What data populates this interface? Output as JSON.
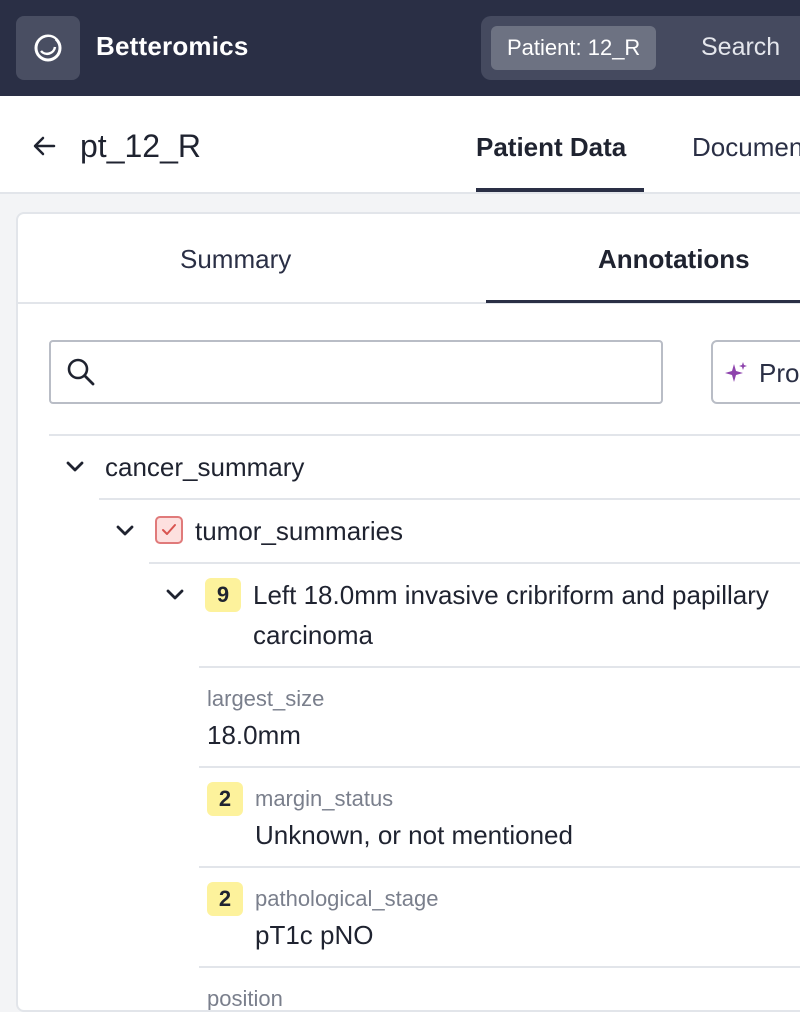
{
  "topbar": {
    "brand": "Betteromics",
    "patient_chip": "Patient: 12_R",
    "search_label": "Search"
  },
  "header": {
    "title": "pt_12_R",
    "tabs": [
      {
        "label": "Patient Data",
        "active": true
      },
      {
        "label": "Documents",
        "active": false
      }
    ]
  },
  "subtabs": [
    {
      "label": "Summary",
      "active": false
    },
    {
      "label": "Annotations",
      "active": true
    }
  ],
  "search": {
    "value": "",
    "placeholder": ""
  },
  "prompt_button": {
    "label": "Prompt"
  },
  "tree": {
    "root": {
      "label": "cancer_summary",
      "expanded": true
    },
    "child": {
      "label": "tumor_summaries",
      "checked": true,
      "expanded": true
    },
    "item": {
      "badge": "9",
      "line1": "Left 18.0mm invasive cribriform and papillary",
      "line2": "carcinoma",
      "expanded": true
    },
    "fields": [
      {
        "key": "largest_size",
        "value": "18.0mm",
        "badge": ""
      },
      {
        "key": "margin_status",
        "value": "Unknown, or not mentioned",
        "badge": "2"
      },
      {
        "key": "pathological_stage",
        "value": "pT1c pNO",
        "badge": "2"
      },
      {
        "key": "position",
        "value": "",
        "badge": ""
      }
    ]
  },
  "colors": {
    "topbar": "#2a2f45",
    "badge": "#fdf29c",
    "checkbox_border": "#e07a7a",
    "sparkle": "#8e44ad"
  }
}
